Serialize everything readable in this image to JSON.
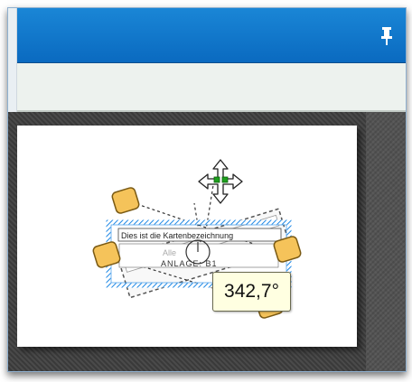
{
  "window": {
    "pin_icon": "pin-icon",
    "title_color": "#0a74c8",
    "toolbar_color": "#edf2ee"
  },
  "drawing": {
    "label_text": "Dies ist die Kartenbezeichnung",
    "sub_text_faded": "Alle",
    "main_text": "ANLAGE: B1",
    "move_icon": "move-arrows-icon",
    "rotate_icon": "rotate-handle-icon",
    "selection_color": "#1e88e5",
    "handle_color": "#f5c35a"
  },
  "tooltip": {
    "angle": "342,7°"
  }
}
